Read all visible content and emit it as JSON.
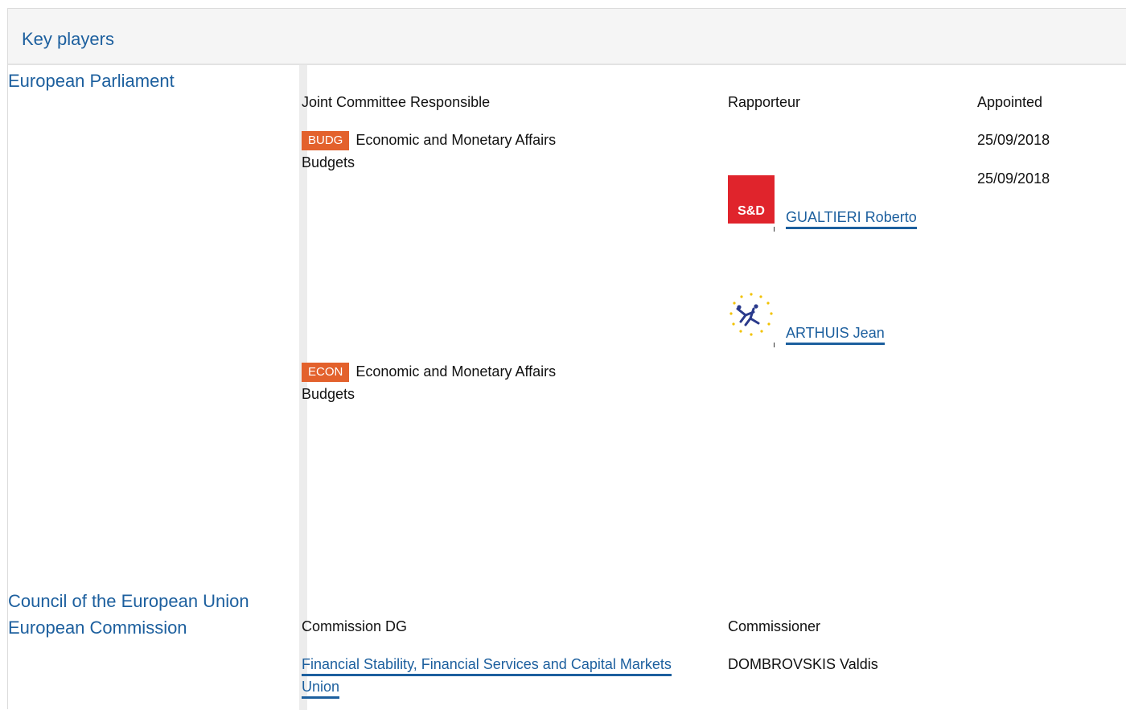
{
  "header": {
    "title": "Key players"
  },
  "institutions": {
    "parliament": "European Parliament",
    "council": "Council of the European Union",
    "commission": "European Commission"
  },
  "parliament_table": {
    "col_committee": "Joint Committee Responsible",
    "col_rapporteur": "Rapporteur",
    "col_appointed": "Appointed",
    "committees": [
      {
        "badge": "BUDG",
        "line1": "Economic and Monetary Affairs",
        "line2": "Budgets",
        "badge_color": "#e3612c"
      },
      {
        "badge": "ECON",
        "line1": "Economic and Monetary Affairs",
        "line2": "Budgets",
        "badge_color": "#e3612c"
      }
    ],
    "appointed": [
      "25/09/2018",
      "25/09/2018"
    ],
    "rapporteurs": [
      {
        "name": "GUALTIERI Roberto",
        "party_logo": "S&D",
        "logo_color": "#e0242c"
      },
      {
        "name": "ARTHUIS Jean",
        "party_logo": "ALDE-icon",
        "logo_color": "#2a3a8c"
      }
    ]
  },
  "commission_table": {
    "col_dg": "Commission DG",
    "col_commissioner": "Commissioner",
    "dg": "Financial Stability, Financial Services and Capital Markets Union",
    "commissioner": "DOMBROVSKIS Valdis"
  },
  "colors": {
    "link": "#1c5f9e",
    "badge": "#e3612c"
  }
}
